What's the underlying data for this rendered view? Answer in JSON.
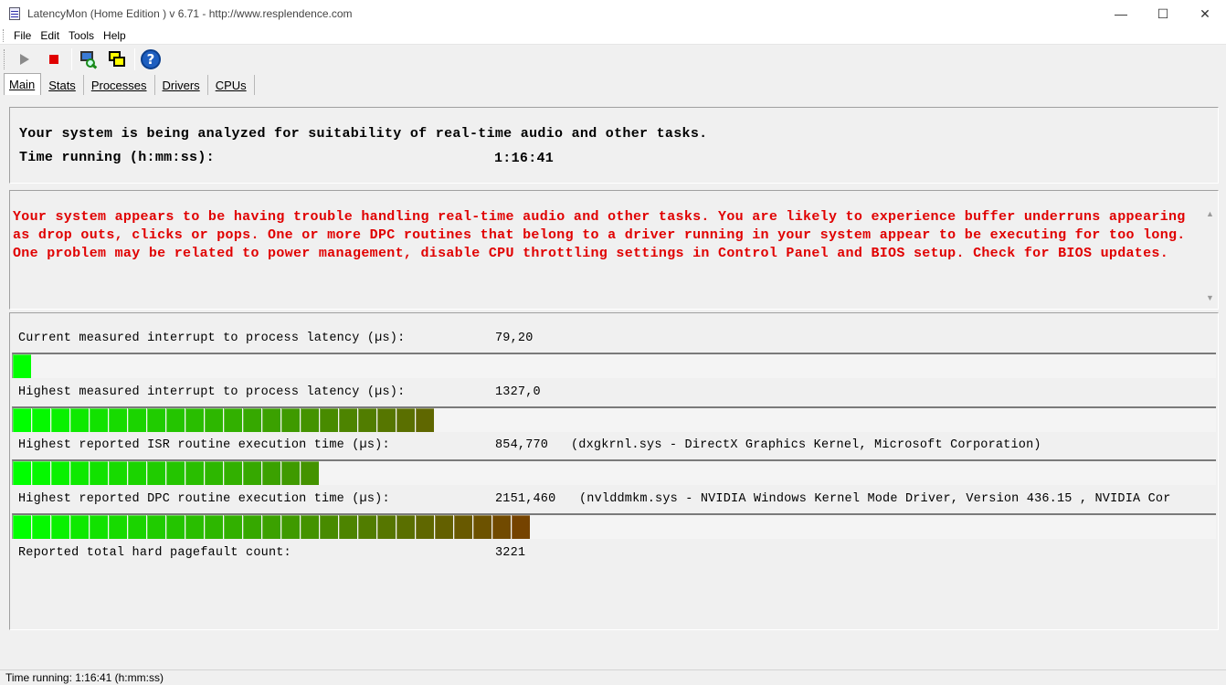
{
  "window": {
    "title": "LatencyMon  (Home Edition )  v 6.71 - http://www.resplendence.com",
    "controls": {
      "minimize": "—",
      "maximize": "☐",
      "close": "✕"
    }
  },
  "menu": [
    "File",
    "Edit",
    "Tools",
    "Help"
  ],
  "toolbar": {
    "buttons": [
      "play-icon",
      "stop-icon",
      "analyze-icon",
      "windows-icon",
      "help-icon"
    ],
    "help_glyph": "?"
  },
  "tabs": [
    "Main",
    "Stats",
    "Processes",
    "Drivers",
    "CPUs"
  ],
  "active_tab": "Main",
  "analysis": {
    "line1": "Your system is being analyzed for suitability of real-time audio and other tasks.",
    "time_label": "Time running (h:mm:ss):",
    "time_value": "1:16:41"
  },
  "warning": {
    "text": "Your system appears to be having trouble handling real-time audio and other tasks. You are likely to experience buffer underruns appearing as drop outs, clicks or pops. One or more DPC routines that belong to a driver running in your system appear to be executing for too long. One problem may be related to power management, disable CPU throttling settings in Control Panel and BIOS setup. Check for BIOS updates.",
    "color": "#e00000",
    "scroll_up": "▲",
    "scroll_down": "▼"
  },
  "metrics": [
    {
      "label": "Current measured interrupt to process latency (µs):",
      "value": "79,20",
      "extra": "",
      "bar_segments": 1
    },
    {
      "label": "Highest measured interrupt to process latency (µs):",
      "value": "1327,0",
      "extra": "",
      "bar_segments": 22
    },
    {
      "label": "Highest reported ISR routine execution time (µs):",
      "value": "854,770",
      "extra": "(dxgkrnl.sys - DirectX Graphics Kernel, Microsoft Corporation)",
      "bar_segments": 16
    },
    {
      "label": "Highest reported DPC routine execution time (µs):",
      "value": "2151,460",
      "extra": "(nvlddmkm.sys - NVIDIA Windows Kernel Mode Driver, Version 436.15 , NVIDIA Cor",
      "bar_segments": 27
    }
  ],
  "pagefault": {
    "label": "Reported total hard pagefault count:",
    "value": "3221"
  },
  "bar_colors": {
    "start": "#00ff00",
    "end": "#7a3c00"
  },
  "status": "Time running: 1:16:41  (h:mm:ss)"
}
